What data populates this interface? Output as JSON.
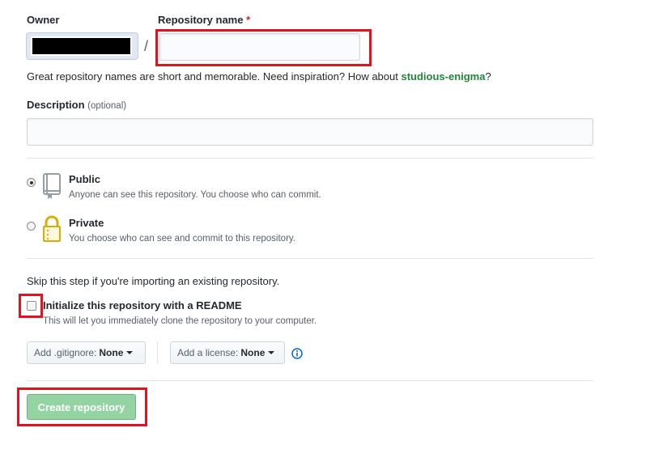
{
  "owner": {
    "label": "Owner"
  },
  "repo": {
    "label": "Repository name",
    "required_mark": "*",
    "separator": "/",
    "value": ""
  },
  "hint": {
    "text": "Great repository names are short and memorable. Need inspiration? How about ",
    "suggestion": "studious-enigma",
    "end": "?"
  },
  "description": {
    "label": "Description",
    "optional": "(optional)",
    "value": ""
  },
  "visibility": {
    "public": {
      "title": "Public",
      "subtitle": "Anyone can see this repository. You choose who can commit.",
      "selected": true,
      "icon": "repo-book-icon"
    },
    "private": {
      "title": "Private",
      "subtitle": "You choose who can see and commit to this repository.",
      "selected": false,
      "icon": "lock-icon"
    }
  },
  "init": {
    "skip_note": "Skip this step if you're importing an existing repository.",
    "readme_label": "Initialize this repository with a README",
    "readme_subtitle": "This will let you immediately clone the repository to your computer.",
    "readme_checked": false
  },
  "gitignore": {
    "prefix": "Add .gitignore:",
    "value": "None"
  },
  "license": {
    "prefix": "Add a license:",
    "value": "None",
    "info_icon": "info-icon"
  },
  "submit": {
    "label": "Create repository",
    "disabled": true
  },
  "colors": {
    "highlight": "#e0141e",
    "suggestion": "#22863a",
    "button_disabled": "#94d3a2",
    "info": "#0366d6"
  }
}
